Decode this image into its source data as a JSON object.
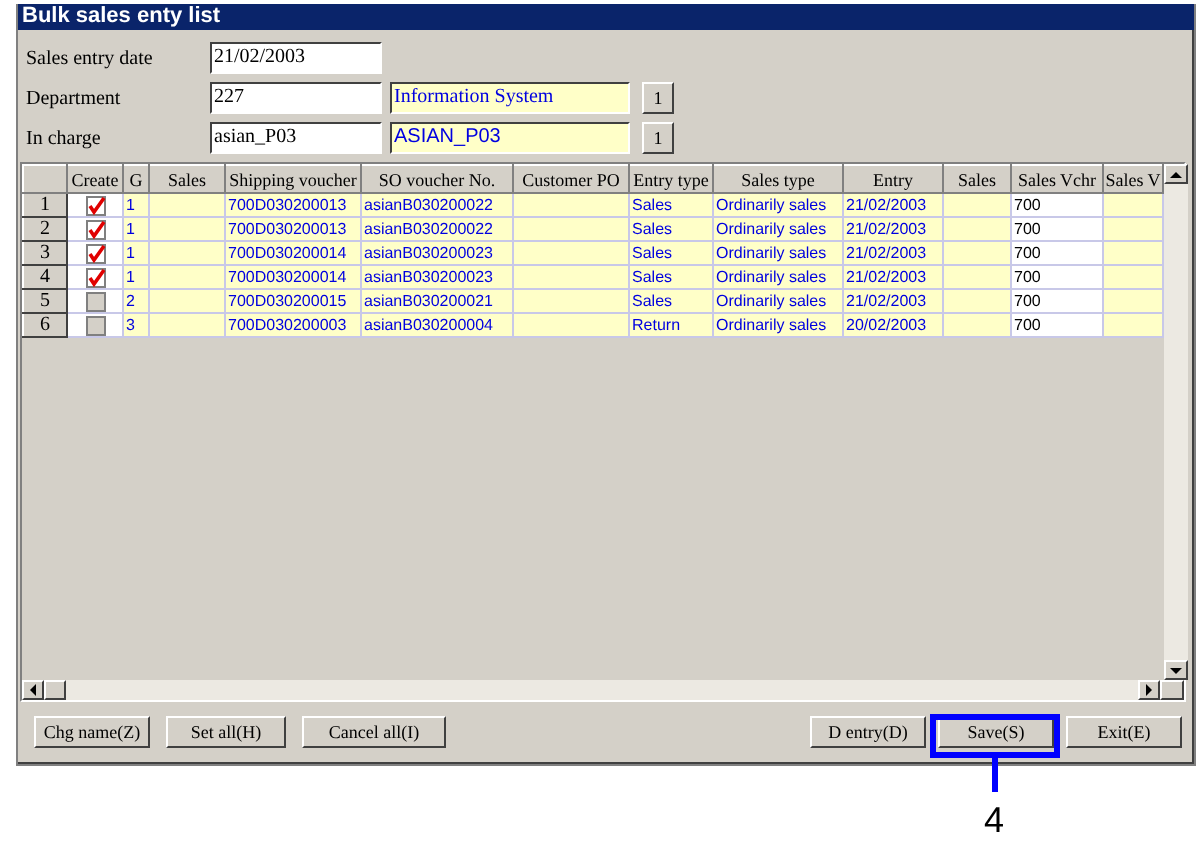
{
  "window": {
    "title": "Bulk sales enty list"
  },
  "fields": [
    {
      "label": "Sales entry date",
      "value": "21/02/2003"
    },
    {
      "label": "Department",
      "value": "227",
      "name_value": "Information System",
      "lookup": "1"
    },
    {
      "label": "In charge",
      "value": "asian_P03",
      "name_value": "ASIAN_P03",
      "lookup": "1"
    }
  ],
  "table": {
    "columns": [
      {
        "label": "Create",
        "kind": "check"
      },
      {
        "label": "G",
        "kind": "text"
      },
      {
        "label": "Sales",
        "kind": "text"
      },
      {
        "label": "Shipping voucher",
        "kind": "text"
      },
      {
        "label": "SO voucher No.",
        "kind": "text"
      },
      {
        "label": "Customer PO",
        "kind": "text"
      },
      {
        "label": "Entry type",
        "kind": "text"
      },
      {
        "label": "Sales type",
        "kind": "text"
      },
      {
        "label": "Entry",
        "kind": "text"
      },
      {
        "label": "Sales",
        "kind": "text"
      },
      {
        "label": "Sales Vchr",
        "kind": "input"
      },
      {
        "label": "Sales V",
        "kind": "text"
      }
    ],
    "rows": [
      {
        "number": "1",
        "cells": [
          {
            "checked": true
          },
          "1",
          "",
          "700D030200013",
          "asianB030200022",
          "",
          "Sales",
          "Ordinarily sales",
          "21/02/2003",
          "",
          "700",
          ""
        ]
      },
      {
        "number": "2",
        "cells": [
          {
            "checked": true
          },
          "1",
          "",
          "700D030200013",
          "asianB030200022",
          "",
          "Sales",
          "Ordinarily sales",
          "21/02/2003",
          "",
          "700",
          ""
        ]
      },
      {
        "number": "3",
        "cells": [
          {
            "checked": true
          },
          "1",
          "",
          "700D030200014",
          "asianB030200023",
          "",
          "Sales",
          "Ordinarily sales",
          "21/02/2003",
          "",
          "700",
          ""
        ]
      },
      {
        "number": "4",
        "cells": [
          {
            "checked": true
          },
          "1",
          "",
          "700D030200014",
          "asianB030200023",
          "",
          "Sales",
          "Ordinarily sales",
          "21/02/2003",
          "",
          "700",
          ""
        ]
      },
      {
        "number": "5",
        "cells": [
          {
            "checked": false
          },
          "2",
          "",
          "700D030200015",
          "asianB030200021",
          "",
          "Sales",
          "Ordinarily sales",
          "21/02/2003",
          "",
          "700",
          ""
        ]
      },
      {
        "number": "6",
        "cells": [
          {
            "checked": false
          },
          "3",
          "",
          "700D030200003",
          "asianB030200004",
          "",
          "Return",
          "Ordinarily sales",
          "20/02/2003",
          "",
          "700",
          ""
        ]
      }
    ]
  },
  "buttons_left": [
    "Chg name(Z)",
    "Set all(H)",
    "Cancel all(I)"
  ],
  "buttons_right": [
    {
      "label": "D entry(D)",
      "highlighted": false
    },
    {
      "label": "Save(S)",
      "highlighted": true
    },
    {
      "label": "Exit(E)",
      "highlighted": false
    }
  ],
  "callout": {
    "label": "4"
  }
}
